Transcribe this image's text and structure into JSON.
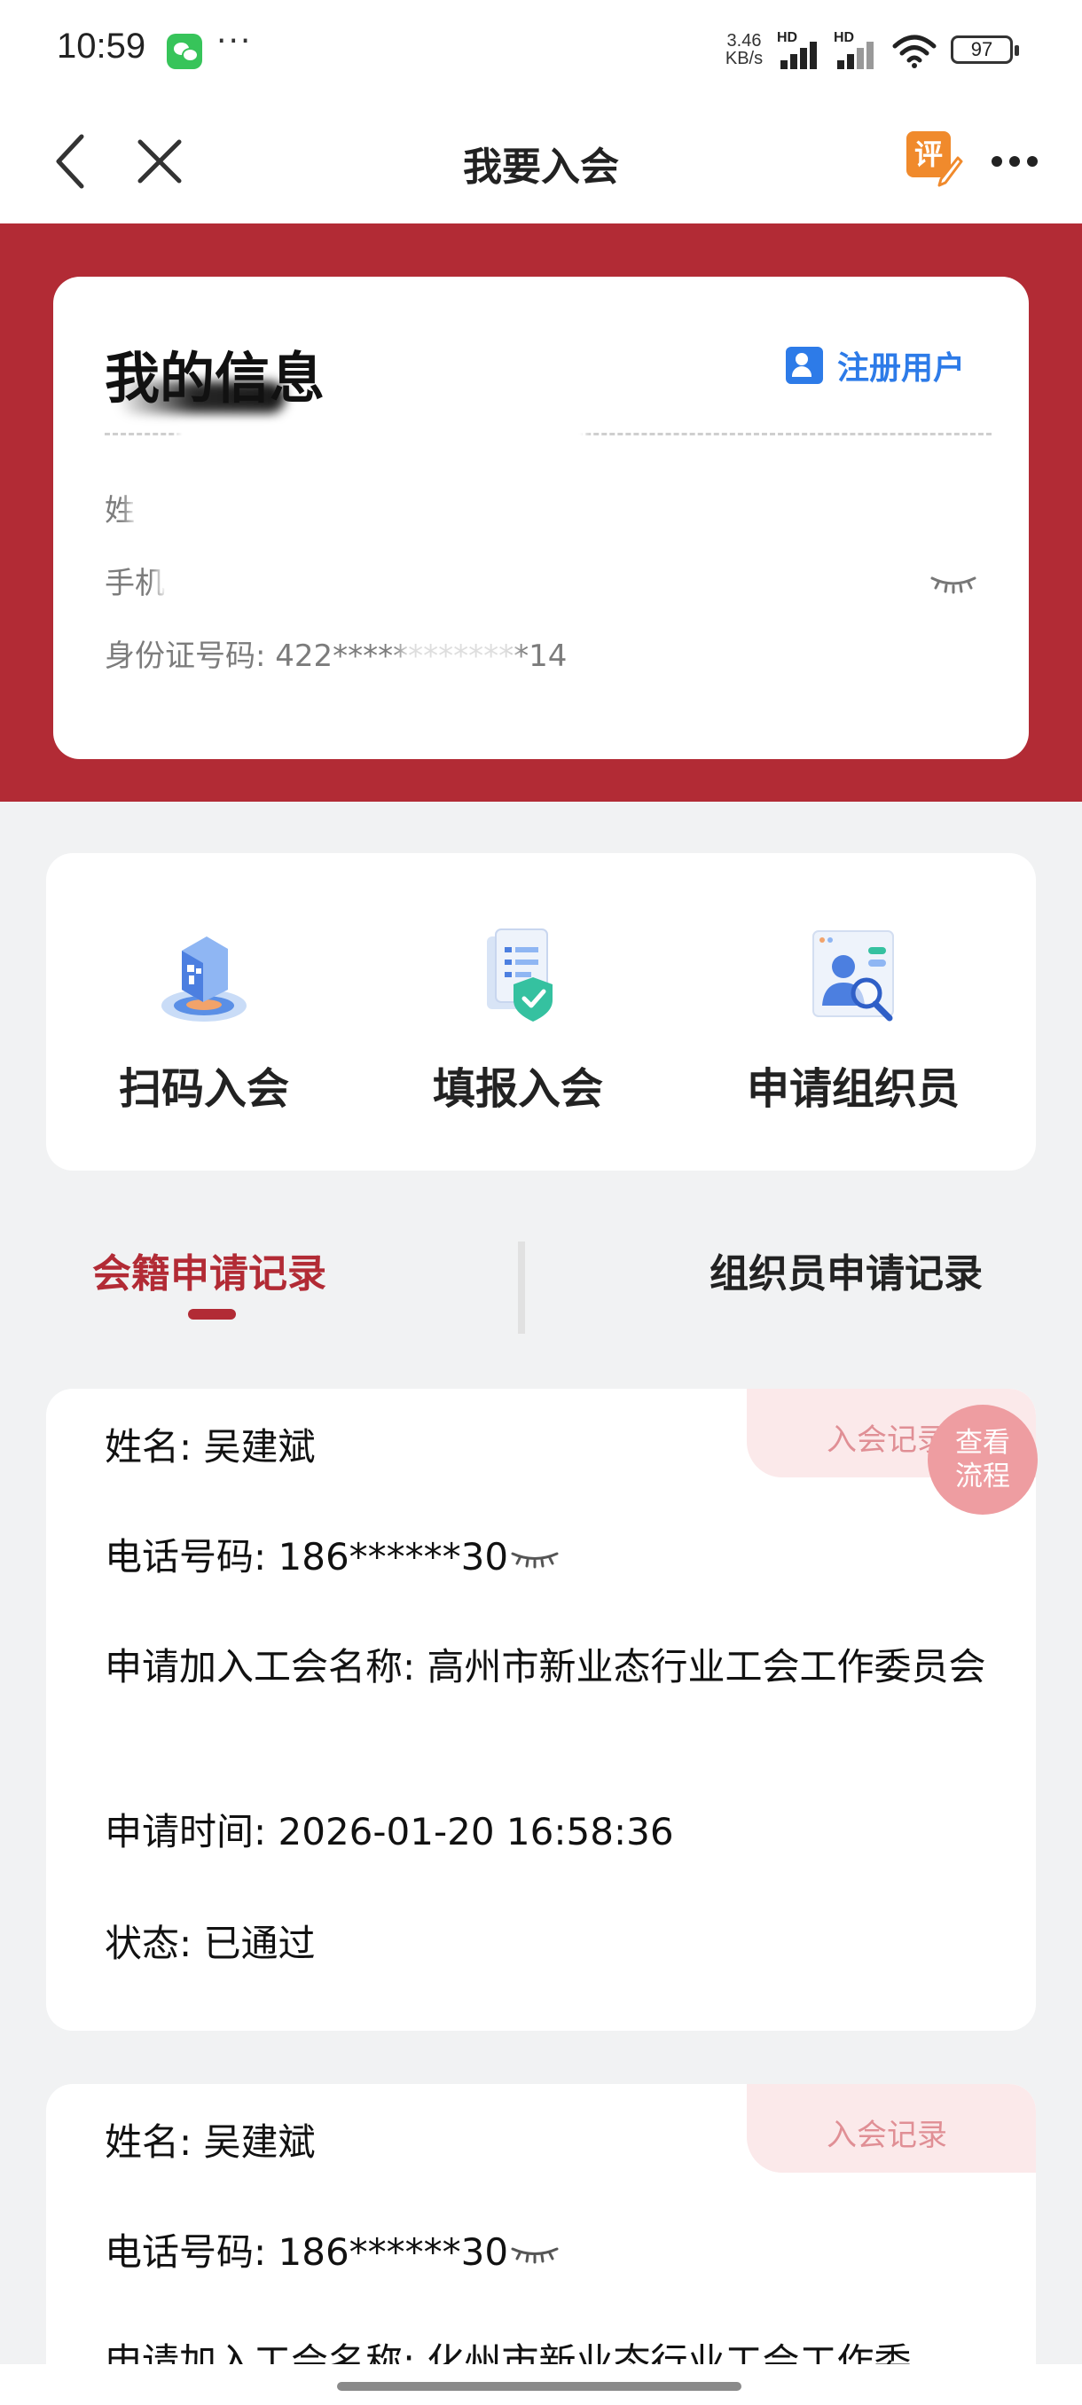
{
  "status_bar": {
    "time": "10:59",
    "more": "···",
    "net_speed_value": "3.46",
    "net_speed_unit": "KB/s",
    "signal1_label": "HD",
    "signal2_label": "HD",
    "battery": "97"
  },
  "nav": {
    "title": "我要入会",
    "review_badge": "评"
  },
  "my_info": {
    "title": "我的信息",
    "register_label": "注册用户",
    "name_label": "姓",
    "phone_label": "手机",
    "id_label": "身份证号码: 422",
    "id_masked": "*************14"
  },
  "actions": [
    {
      "label": "扫码入会",
      "icon": "qr-scan-icon"
    },
    {
      "label": "填报入会",
      "icon": "form-check-icon"
    },
    {
      "label": "申请组织员",
      "icon": "person-search-icon"
    }
  ],
  "tabs": {
    "active": "会籍申请记录",
    "inactive": "组织员申请记录"
  },
  "records": [
    {
      "tag": "入会记录",
      "name": "姓名: 吴建斌",
      "phone": "电话号码: 186******30",
      "union": "申请加入工会名称: 高州市新业态行业工会工作委员会",
      "time": "申请时间: 2026-01-20 16:58:36",
      "status": "状态: 已通过"
    },
    {
      "tag": "入会记录",
      "name": "姓名: 吴建斌",
      "phone": "电话号码: 186******30",
      "union": "申请加入工会名称: 化州市新业态行业工会工作委"
    }
  ],
  "flow_button": {
    "line1": "查看",
    "line2": "流程"
  },
  "colors": {
    "primary_red": "#b22b35",
    "link_blue": "#2d7be8",
    "tag_bg": "#fbe9ea",
    "tag_text": "#e08f95",
    "flow_bg": "#ee9da1"
  }
}
